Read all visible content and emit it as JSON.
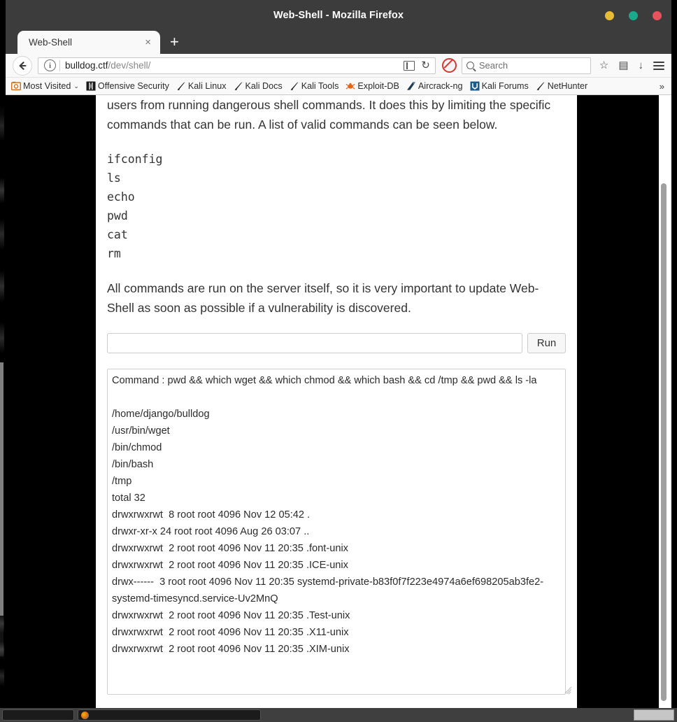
{
  "window": {
    "title": "Web-Shell - Mozilla Firefox",
    "buttons": {
      "minimize": "minimize",
      "maximize": "maximize",
      "close": "close"
    }
  },
  "tabs": [
    {
      "title": "Web-Shell",
      "close_label": "×"
    }
  ],
  "new_tab_label": "+",
  "nav": {
    "back_label": "←",
    "reload_label": "↻",
    "url_host": "bulldog.ctf",
    "url_path": "/dev/shell/",
    "star_label": "☆",
    "library_label": "▤",
    "download_label": "↓"
  },
  "search": {
    "placeholder": "Search"
  },
  "bookmarks": {
    "items": [
      {
        "label": "Most Visited",
        "icon": "most-visited-icon",
        "caret": "⌄"
      },
      {
        "label": "Offensive Security",
        "icon": "offensive-security-icon"
      },
      {
        "label": "Kali Linux",
        "icon": "kali-dragon-icon"
      },
      {
        "label": "Kali Docs",
        "icon": "kali-dragon-icon"
      },
      {
        "label": "Kali Tools",
        "icon": "kali-dragon-icon"
      },
      {
        "label": "Exploit-DB",
        "icon": "exploit-db-icon"
      },
      {
        "label": "Aircrack-ng",
        "icon": "aircrack-ng-icon"
      },
      {
        "label": "Kali Forums",
        "icon": "kali-forums-icon"
      },
      {
        "label": "NetHunter",
        "icon": "kali-dragon-icon"
      }
    ],
    "overflow_label": "»"
  },
  "page": {
    "intro_paragraph": "users from running dangerous shell commands. It does this by limiting the specific commands that can be run. A list of valid commands can be seen below.",
    "valid_commands": [
      "ifconfig",
      "ls",
      "echo",
      "pwd",
      "cat",
      "rm"
    ],
    "warning_paragraph": "All commands are run on the server itself, so it is very important to update Web-Shell as soon as possible if a vulnerability is discovered.",
    "command_input": {
      "value": "",
      "placeholder": ""
    },
    "run_button_label": "Run",
    "output": "Command : pwd && which wget && which chmod && which bash && cd /tmp && pwd && ls -la\n\n/home/django/bulldog\n/usr/bin/wget\n/bin/chmod\n/bin/bash\n/tmp\ntotal 32\ndrwxrwxrwt  8 root root 4096 Nov 12 05:42 .\ndrwxr-xr-x 24 root root 4096 Aug 26 03:07 ..\ndrwxrwxrwt  2 root root 4096 Nov 11 20:35 .font-unix\ndrwxrwxrwt  2 root root 4096 Nov 11 20:35 .ICE-unix\ndrwx------  3 root root 4096 Nov 11 20:35 systemd-private-b83f0f7f223e4974a6ef698205ab3fe2-systemd-timesyncd.service-Uv2MnQ\ndrwxrwxrwt  2 root root 4096 Nov 11 20:35 .Test-unix\ndrwxrwxrwt  2 root root 4096 Nov 11 20:35 .X11-unix\ndrwxrwxrwt  2 root root 4096 Nov 11 20:35 .XIM-unix"
  },
  "taskbar": {
    "items": [
      {
        "label": "",
        "icon": ""
      },
      {
        "label": "",
        "icon": "firefox-icon"
      }
    ]
  },
  "colors": {
    "titlebar_bg": "#3c3c3c",
    "chrome_bg": "#f9f9f9",
    "minimize": "#e8bb36",
    "maximize": "#1aa98b",
    "close": "#e8525f",
    "desktop_bg": "#000000",
    "page_text": "#333333"
  }
}
